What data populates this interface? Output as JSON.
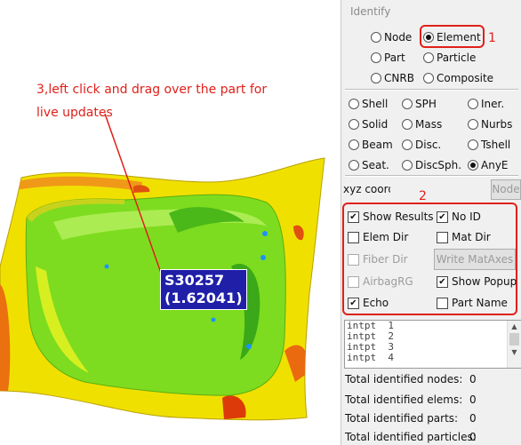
{
  "annotation": {
    "lines": [
      "3,left click and drag over the part for",
      "live updates"
    ],
    "step1": "1",
    "step2": "2"
  },
  "popup": {
    "line1": "S30257",
    "line2": "(1.62041)"
  },
  "panel": {
    "title": "Identify",
    "entity_radios": [
      {
        "label": "Node",
        "selected": false
      },
      {
        "label": "Element",
        "selected": true
      },
      {
        "label": "Part",
        "selected": false
      },
      {
        "label": "Particle",
        "selected": false
      },
      {
        "label": "CNRB",
        "selected": false
      },
      {
        "label": "Composite",
        "selected": false
      }
    ],
    "element_radios": [
      {
        "label": "Shell",
        "selected": false
      },
      {
        "label": "SPH",
        "selected": false
      },
      {
        "label": "Iner.",
        "selected": false
      },
      {
        "label": "Solid",
        "selected": false
      },
      {
        "label": "Mass",
        "selected": false
      },
      {
        "label": "Nurbs",
        "selected": false
      },
      {
        "label": "Beam",
        "selected": false
      },
      {
        "label": "Disc.",
        "selected": false
      },
      {
        "label": "Tshell",
        "selected": false
      },
      {
        "label": "Seat.",
        "selected": false
      },
      {
        "label": "DiscSph.",
        "selected": false
      },
      {
        "label": "AnyE",
        "selected": true
      }
    ],
    "xyz_label": "xyz coord",
    "xyz_value": "",
    "node_button": "Node",
    "options": [
      {
        "label": "Show Results",
        "checked": true,
        "enabled": true
      },
      {
        "label": "No ID",
        "checked": true,
        "enabled": true
      },
      {
        "label": "Elem Dir",
        "checked": false,
        "enabled": true
      },
      {
        "label": "Mat Dir",
        "checked": false,
        "enabled": true
      },
      {
        "label": "Fiber Dir",
        "checked": false,
        "enabled": false
      },
      {
        "label": "AirbagRG",
        "checked": false,
        "enabled": false
      },
      {
        "label": "Show Popup",
        "checked": true,
        "enabled": true
      },
      {
        "label": "Echo",
        "checked": true,
        "enabled": true
      },
      {
        "label": "Part Name",
        "checked": false,
        "enabled": true
      }
    ],
    "write_button": "Write MatAxes",
    "intpt_list": [
      {
        "name": "intpt",
        "num": "1"
      },
      {
        "name": "intpt",
        "num": "2"
      },
      {
        "name": "intpt",
        "num": "3"
      },
      {
        "name": "intpt",
        "num": "4"
      }
    ],
    "stats": [
      {
        "label": "Total identified nodes:",
        "value": "0"
      },
      {
        "label": "Total identified elems:",
        "value": "0"
      },
      {
        "label": "Total identified parts:",
        "value": "0"
      },
      {
        "label": "Total identified particles:",
        "value": "0"
      }
    ]
  },
  "colors": {
    "annotation_red": "#e0201a",
    "popup_blue": "#1f1fa8",
    "contour_yellow": "#f0e000",
    "contour_green": "#7ddc1f",
    "contour_orange": "#f07f10",
    "contour_red": "#e23a0a",
    "contour_blue": "#1e90ff"
  }
}
